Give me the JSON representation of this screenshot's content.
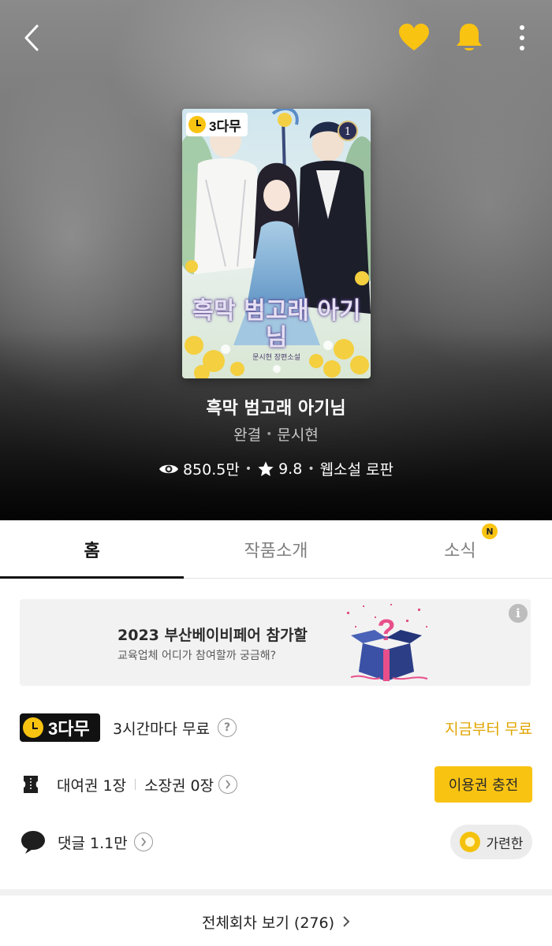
{
  "header": {
    "back_icon": "chevron-left-icon",
    "favorite_icon": "heart-icon",
    "notification_icon": "bell-icon",
    "more_icon": "more-vertical-icon",
    "accent_color": "#f9c312"
  },
  "cover": {
    "badge_text": "3다무",
    "title_text": "흑막 범고래 아기님",
    "subtitle_text": "문시현 장편소설"
  },
  "work": {
    "title": "흑막 범고래 아기님",
    "status": "완결",
    "author": "문시현",
    "views": "850.5만",
    "rating": "9.8",
    "genre": "웹소설 로판"
  },
  "tabs": [
    {
      "label": "홈",
      "active": true
    },
    {
      "label": "작품소개",
      "active": false
    },
    {
      "label": "소식",
      "active": false,
      "badge": "N"
    }
  ],
  "banner": {
    "title": "2023 부산베이비페어 참가할",
    "subtitle": "교육업체 어디가 참여할까 궁금해?",
    "info_icon": "i"
  },
  "free_row": {
    "badge": "3다무",
    "text": "3시간마다 무료",
    "help": "?",
    "link": "지금부터 무료"
  },
  "ticket_row": {
    "rental": "대여권 1장",
    "owned": "소장권 0장",
    "button": "이용권 충전"
  },
  "comment_row": {
    "comments": "댓글 1.1만",
    "filter_button": "가련한"
  },
  "footer": {
    "all_episodes": "전체회차 보기 (276)"
  }
}
